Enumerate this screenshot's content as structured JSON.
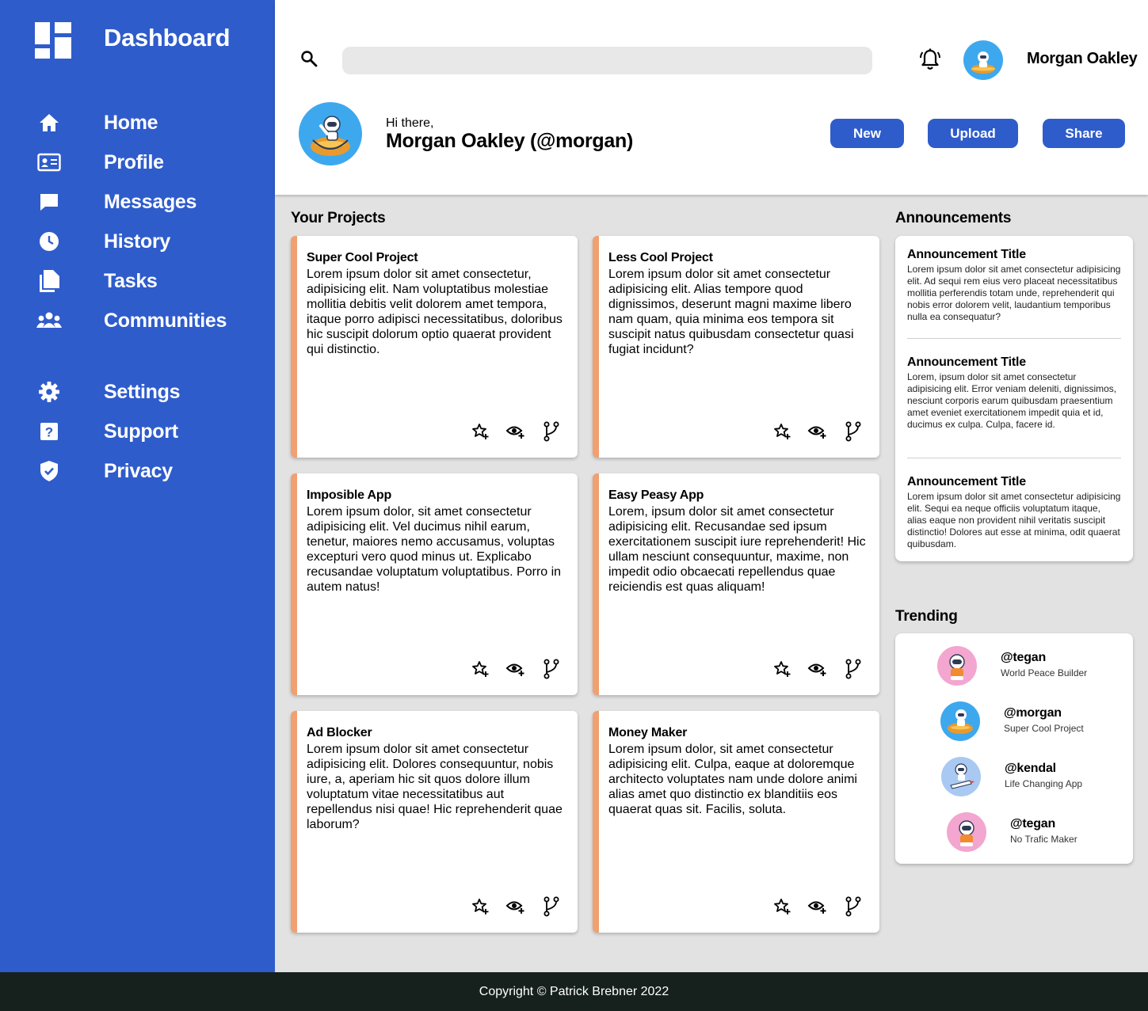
{
  "sidebar": {
    "brand_title": "Dashboard",
    "items": [
      {
        "label": "Home",
        "icon": "home-icon"
      },
      {
        "label": "Profile",
        "icon": "id-card-icon"
      },
      {
        "label": "Messages",
        "icon": "message-icon"
      },
      {
        "label": "History",
        "icon": "clock-icon"
      },
      {
        "label": "Tasks",
        "icon": "documents-icon"
      },
      {
        "label": "Communities",
        "icon": "people-icon"
      },
      {
        "label": "Settings",
        "icon": "gear-icon"
      },
      {
        "label": "Support",
        "icon": "help-icon"
      },
      {
        "label": "Privacy",
        "icon": "shield-icon"
      }
    ]
  },
  "header": {
    "search_placeholder": "",
    "username": "Morgan Oakley",
    "greeting": "Hi there,",
    "greeting_name": "Morgan Oakley (@morgan)",
    "buttons": {
      "new": "New",
      "upload": "Upload",
      "share": "Share"
    }
  },
  "projects": {
    "heading": "Your Projects",
    "items": [
      {
        "title": "Super Cool Project",
        "text": "Lorem ipsum dolor sit amet consectetur, adipisicing elit. Nam voluptatibus molestiae mollitia debitis velit dolorem amet tempora, itaque porro adipisci necessitatibus, doloribus hic suscipit dolorum optio quaerat provident qui distinctio."
      },
      {
        "title": "Less Cool Project",
        "text": "Lorem ipsum dolor sit amet consectetur adipisicing elit. Alias tempore quod dignissimos, deserunt magni maxime libero nam quam, quia minima eos tempora sit suscipit natus quibusdam consectetur quasi fugiat incidunt?"
      },
      {
        "title": "Imposible App",
        "text": "Lorem ipsum dolor, sit amet consectetur adipisicing elit. Vel ducimus nihil earum, tenetur, maiores nemo accusamus, voluptas excepturi vero quod minus ut. Explicabo recusandae voluptatum voluptatibus. Porro in autem natus!"
      },
      {
        "title": "Easy Peasy App",
        "text": "Lorem, ipsum dolor sit amet consectetur adipisicing elit. Recusandae sed ipsum exercitationem suscipit iure reprehenderit! Hic ullam nesciunt consequuntur, maxime, non impedit odio obcaecati repellendus quae reiciendis est quas aliquam!"
      },
      {
        "title": "Ad Blocker",
        "text": "Lorem ipsum dolor sit amet consectetur adipisicing elit. Dolores consequuntur, nobis iure, a, aperiam hic sit quos dolore illum voluptatum vitae necessitatibus aut repellendus nisi quae! Hic reprehenderit quae laborum?"
      },
      {
        "title": "Money Maker",
        "text": "Lorem ipsum dolor, sit amet consectetur adipisicing elit. Culpa, eaque at doloremque architecto voluptates nam unde dolore animi alias amet quo distinctio ex blanditiis eos quaerat quas sit. Facilis, soluta."
      }
    ]
  },
  "announcements": {
    "heading": "Announcements",
    "items": [
      {
        "title": "Announcement Title",
        "text": "Lorem ipsum dolor sit amet consectetur adipisicing elit. Ad sequi rem eius vero placeat necessitatibus mollitia perferendis totam unde, reprehenderit qui nobis error dolorem velit, laudantium temporibus nulla ea consequatur?"
      },
      {
        "title": "Announcement Title",
        "text": "Lorem, ipsum dolor sit amet consectetur adipisicing elit. Error veniam deleniti, dignissimos, nesciunt corporis earum quibusdam praesentium amet eveniet exercitationem impedit quia et id, ducimus ex culpa. Culpa, facere id."
      },
      {
        "title": "Announcement Title",
        "text": "Lorem ipsum dolor sit amet consectetur adipisicing elit. Sequi ea neque officiis voluptatum itaque, alias eaque non provident nihil veritatis suscipit distinctio! Dolores aut esse at minima, odit quaerat quibusdam."
      }
    ]
  },
  "trending": {
    "heading": "Trending",
    "items": [
      {
        "handle": "@tegan",
        "subtitle": "World Peace Builder",
        "avatar_color": "#f3a6cf"
      },
      {
        "handle": "@morgan",
        "subtitle": "Super Cool Project",
        "avatar_color": "#3ea8ee"
      },
      {
        "handle": "@kendal",
        "subtitle": "Life Changing App",
        "avatar_color": "#a9c9f2"
      },
      {
        "handle": "@tegan",
        "subtitle": "No Trafic Maker",
        "avatar_color": "#f3a6cf"
      }
    ]
  },
  "footer": {
    "text": "Copyright © Patrick Brebner 2022"
  },
  "colors": {
    "sidebar": "#2f5ccb",
    "accent": "#2f5ccb",
    "card_border": "#f0a071",
    "footer": "#16211e",
    "background": "#e2e2e2"
  }
}
